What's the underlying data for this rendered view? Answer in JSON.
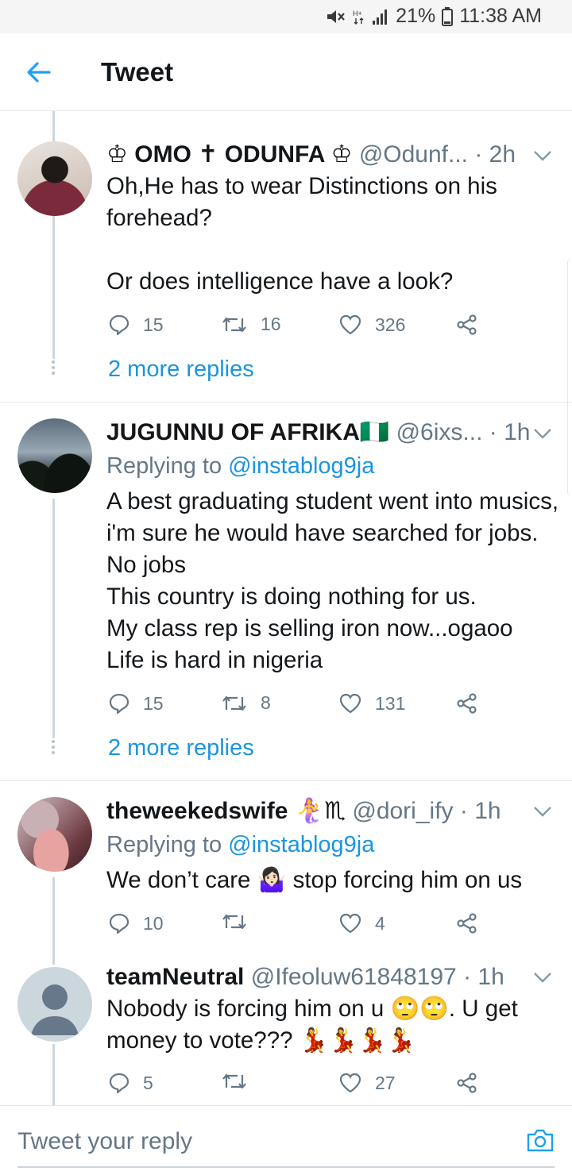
{
  "status_bar": {
    "battery": "21%",
    "time": "11:38 AM"
  },
  "header": {
    "title": "Tweet"
  },
  "tweets": [
    {
      "name": "♔ OMO ✝ ODUNFA ♔",
      "handle": "@Odunf...",
      "time": "· 2h",
      "replying_to_label": "",
      "replying_to": "",
      "text": "Oh,He has to wear Distinctions on his forehead?\n\nOr does intelligence have a look?",
      "replies": "15",
      "retweets": "16",
      "likes": "326",
      "more_replies": "2 more replies"
    },
    {
      "name": "JUGUNNU OF AFRIKA🇳🇬",
      "handle": "@6ixs...",
      "time": "· 1h",
      "replying_to_label": "Replying to ",
      "replying_to": "@instablog9ja",
      "text": "A best graduating student went into musics, i'm sure he would have searched for jobs.   No jobs\nThis country is doing nothing for us.\nMy class rep is selling iron now...ogaoo\nLife is hard in nigeria",
      "replies": "15",
      "retweets": "8",
      "likes": "131",
      "more_replies": "2 more replies"
    },
    {
      "name": "theweekedswife 🧜‍♀️♏",
      "handle": "@dori_ify",
      "time": "· 1h",
      "replying_to_label": "Replying to ",
      "replying_to": "@instablog9ja",
      "text": "We don’t care 🤷🏻‍♀️ stop forcing him on us",
      "replies": "10",
      "retweets": "",
      "likes": "4"
    },
    {
      "name": "teamNeutral",
      "handle": "@Ifeoluw61848197",
      "time": "· 1h",
      "text": "Nobody is forcing him on u 🙄🙄. U get money to vote??? 💃💃💃💃",
      "replies": "5",
      "retweets": "",
      "likes": "27"
    }
  ],
  "reply_box": {
    "placeholder": "Tweet your reply"
  },
  "colors": {
    "link": "#1b95e0",
    "muted": "#657786",
    "divider": "#e1e8ed"
  }
}
